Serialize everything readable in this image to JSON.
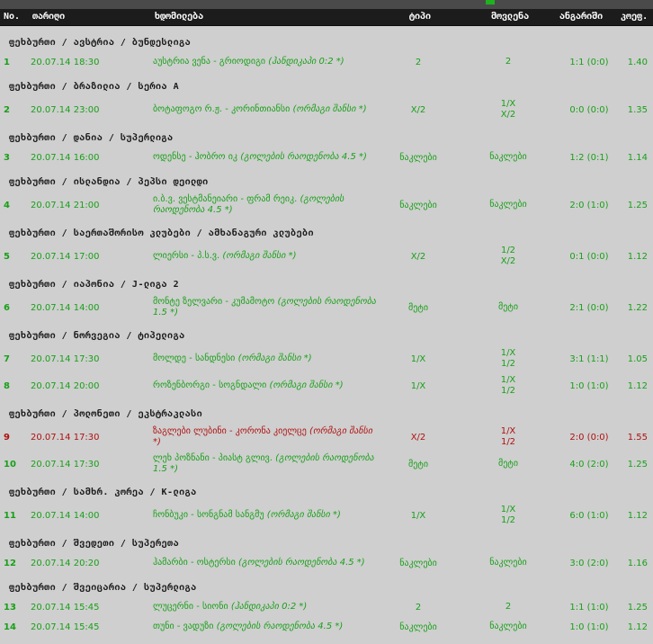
{
  "header": {
    "cols": [
      "No.",
      "თარიღი",
      "ხდომილება",
      "ტიპი",
      "მოვლენა",
      "ანგარიში",
      "კოეფ."
    ]
  },
  "groups": [
    {
      "title": "ფეხბურთი / ავსტრია / ბუნდესლიგა",
      "rows": [
        {
          "no": "1",
          "date": "20.07.14 18:30",
          "event": "აუსტრია ვენა - გრიოდიგი",
          "note": "(ჰანდიკაპი 0:2 *)",
          "type": "2",
          "outcome": [
            "2"
          ],
          "score": "1:1 (0:0)",
          "odds": "1.40",
          "status": "win"
        }
      ]
    },
    {
      "title": "ფეხბურთი / ბრაზილია / სერია A",
      "rows": [
        {
          "no": "2",
          "date": "20.07.14 23:00",
          "event": "ბოტაფოგო რ.ჟ. - კორინთიანსი",
          "note": "(ორმაგი შანსი *)",
          "type": "X/2",
          "outcome": [
            "1/X",
            "X/2"
          ],
          "score": "0:0 (0:0)",
          "odds": "1.35",
          "status": "win"
        }
      ]
    },
    {
      "title": "ფეხბურთი / დანია / სუპერლიგა",
      "rows": [
        {
          "no": "3",
          "date": "20.07.14 16:00",
          "event": "ოდენსე - ჰობრო იკ",
          "note": "(გოლების რაოდენობა 4.5 *)",
          "type": "ნაკლები",
          "outcome": [
            "ნაკლები"
          ],
          "score": "1:2 (0:1)",
          "odds": "1.14",
          "status": "win"
        }
      ]
    },
    {
      "title": "ფეხბურთი / ისლანდია / პეპსი დეილდი",
      "rows": [
        {
          "no": "4",
          "date": "20.07.14 21:00",
          "event": "ი.ბ.ვ. ვესტმანეიარი - ფრამ რეიკ.",
          "note": "(გოლების რაოდენობა 4.5 *)",
          "type": "ნაკლები",
          "outcome": [
            "ნაკლები"
          ],
          "score": "2:0 (1:0)",
          "odds": "1.25",
          "status": "win"
        }
      ]
    },
    {
      "title": "ფეხბურთი / საერთაშორისო კლუბები / ამხანაგური კლუბები",
      "rows": [
        {
          "no": "5",
          "date": "20.07.14 17:00",
          "event": "ლიერსი - პ.ს.ვ.",
          "note": "(ორმაგი შანსი *)",
          "type": "X/2",
          "outcome": [
            "1/2",
            "X/2"
          ],
          "score": "0:1 (0:0)",
          "odds": "1.12",
          "status": "win"
        }
      ]
    },
    {
      "title": "ფეხბურთი / იაპონია / J-ლიგა 2",
      "rows": [
        {
          "no": "6",
          "date": "20.07.14 14:00",
          "event": "მონტე ზელვარი - კუმამოტო",
          "note": "(გოლების რაოდენობა 1.5 *)",
          "type": "მეტი",
          "outcome": [
            "მეტი"
          ],
          "score": "2:1 (0:0)",
          "odds": "1.22",
          "status": "win"
        }
      ]
    },
    {
      "title": "ფეხბურთი / ნორვეგია / ტიპელიგა",
      "rows": [
        {
          "no": "7",
          "date": "20.07.14 17:30",
          "event": "მოლდე - სანდნესი",
          "note": "(ორმაგი შანსი *)",
          "type": "1/X",
          "outcome": [
            "1/X",
            "1/2"
          ],
          "score": "3:1 (1:1)",
          "odds": "1.05",
          "status": "win"
        },
        {
          "no": "8",
          "date": "20.07.14 20:00",
          "event": "როზენბორგი - სოგნდალი",
          "note": "(ორმაგი შანსი *)",
          "type": "1/X",
          "outcome": [
            "1/X",
            "1/2"
          ],
          "score": "1:0 (1:0)",
          "odds": "1.12",
          "status": "win"
        }
      ]
    },
    {
      "title": "ფეხბურთი / პოლონეთი / ეკსტრაკლასი",
      "rows": [
        {
          "no": "9",
          "date": "20.07.14 17:30",
          "event": "ზაგლები ლუბინი - კორონა კიელცე",
          "note": "(ორმაგი შანსი *)",
          "type": "X/2",
          "outcome": [
            "1/X",
            "1/2"
          ],
          "score": "2:0 (0:0)",
          "odds": "1.55",
          "status": "loss"
        },
        {
          "no": "10",
          "date": "20.07.14 17:30",
          "event": "ლეხ პოზნანი - პიასტ გლივ.",
          "note": "(გოლების რაოდენობა 1.5 *)",
          "type": "მეტი",
          "outcome": [
            "მეტი"
          ],
          "score": "4:0 (2:0)",
          "odds": "1.25",
          "status": "win"
        }
      ]
    },
    {
      "title": "ფეხბურთი / სამხრ. კორეა / K-ლიგა",
      "rows": [
        {
          "no": "11",
          "date": "20.07.14 14:00",
          "event": "ჩონბუკი - სონგნამ სანგმუ",
          "note": "(ორმაგი შანსი *)",
          "type": "1/X",
          "outcome": [
            "1/X",
            "1/2"
          ],
          "score": "6:0 (1:0)",
          "odds": "1.12",
          "status": "win"
        }
      ]
    },
    {
      "title": "ფეხბურთი / შვედეთი / სუპერეთა",
      "rows": [
        {
          "no": "12",
          "date": "20.07.14 20:20",
          "event": "ჰამარბი - ოსტერსი",
          "note": "(გოლების რაოდენობა 4.5 *)",
          "type": "ნაკლები",
          "outcome": [
            "ნაკლები"
          ],
          "score": "3:0 (2:0)",
          "odds": "1.16",
          "status": "win"
        }
      ]
    },
    {
      "title": "ფეხბურთი / შვეიცარია / სუპერლიგა",
      "rows": [
        {
          "no": "13",
          "date": "20.07.14 15:45",
          "event": "ლუცერნი - სიონი",
          "note": "(ჰანდიკაპი 0:2 *)",
          "type": "2",
          "outcome": [
            "2"
          ],
          "score": "1:1 (1:0)",
          "odds": "1.25",
          "status": "win"
        },
        {
          "no": "14",
          "date": "20.07.14 15:45",
          "event": "თუნი - ვადუზი",
          "note": "(გოლების რაოდენობა 4.5 *)",
          "type": "ნაკლები",
          "outcome": [
            "ნაკლები"
          ],
          "score": "1:0 (1:0)",
          "odds": "1.12",
          "status": "win"
        }
      ]
    }
  ]
}
